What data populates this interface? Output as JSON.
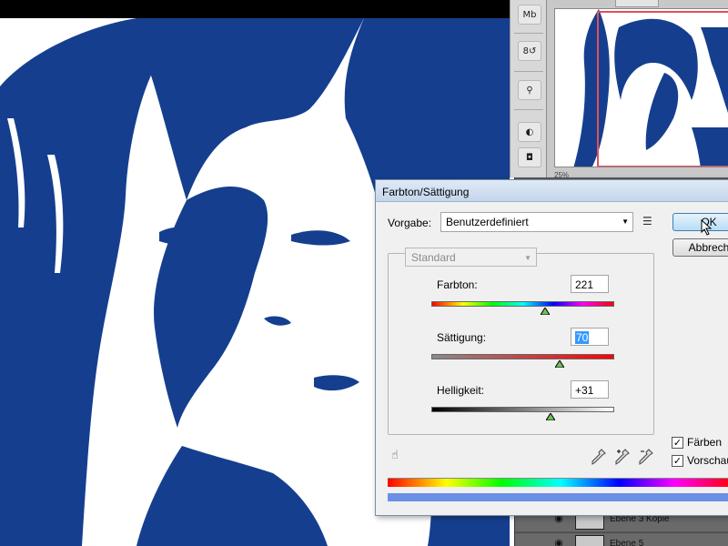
{
  "colors": {
    "image_blue": "#153f8e",
    "selection_blue": "#3399ff",
    "output_bar": "#6b8fe6",
    "nav_frame": "#e0505b"
  },
  "tool_strip": {
    "items": [
      {
        "icon": "mini-bridge-icon",
        "glyph": "Mb"
      },
      {
        "icon": "history-brush-icon",
        "glyph": "8↺"
      },
      {
        "icon": "adjustment-brush-icon",
        "glyph": "⚲"
      },
      {
        "icon": "adjustments-contrast-icon",
        "glyph": "◐"
      },
      {
        "icon": "mask-icon",
        "glyph": "◘"
      }
    ]
  },
  "navigator": {
    "zoom": "25%"
  },
  "layers": {
    "rows": [
      {
        "name": "Ebene 3 Kopie"
      },
      {
        "name": "Ebene 5"
      }
    ]
  },
  "dialog": {
    "title": "Farbton/Sättigung",
    "preset_label": "Vorgabe:",
    "preset_value": "Benutzerdefiniert",
    "ok_label": "OK",
    "cancel_label": "Abbrech",
    "edit_value": "Standard",
    "sliders": {
      "hue": {
        "label": "Farbton:",
        "value": "221",
        "position": 0.62
      },
      "saturation": {
        "label": "Sättigung:",
        "value": "70",
        "position": 0.7
      },
      "lightness": {
        "label": "Helligkeit:",
        "value": "+31",
        "position": 0.65
      }
    },
    "colorize": {
      "label": "Färben",
      "checked": true
    },
    "preview": {
      "label": "Vorschau",
      "checked": true
    }
  }
}
